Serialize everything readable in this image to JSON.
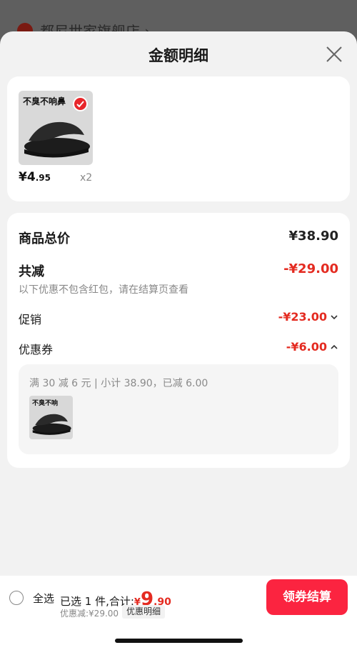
{
  "background": {
    "store_name": "都尼世家旗舰店 ›"
  },
  "sheet": {
    "title": "金额明细"
  },
  "product": {
    "thumb_text": "不臭不响鼻",
    "price_symbol": "¥",
    "price_int": "4",
    "price_dec": ".95",
    "quantity": "x2"
  },
  "summary": {
    "total_label": "商品总价",
    "total_value": "¥38.90",
    "reduce_label": "共减",
    "reduce_value": "-¥29.00",
    "note": "以下优惠不包含红包，请在结算页查看",
    "promo_label": "促销",
    "promo_value": "-¥23.00",
    "coupon_label": "优惠券",
    "coupon_value": "-¥6.00",
    "coupon_desc": "满 30 减 6 元 | 小计 38.90，已减 6.00",
    "mini_thumb_text": "不臭不响"
  },
  "bottom": {
    "select_all": "全选",
    "selected_text": "已选 1 件,合计:",
    "total_yen": "¥",
    "total_int": "9",
    "total_dec": ".90",
    "discount_line": "优惠减:¥29.00",
    "detail_tag": "优惠明细",
    "checkout": "领券结算"
  },
  "colors": {
    "accent_red": "#e42b21",
    "button_red": "#fb2440"
  }
}
